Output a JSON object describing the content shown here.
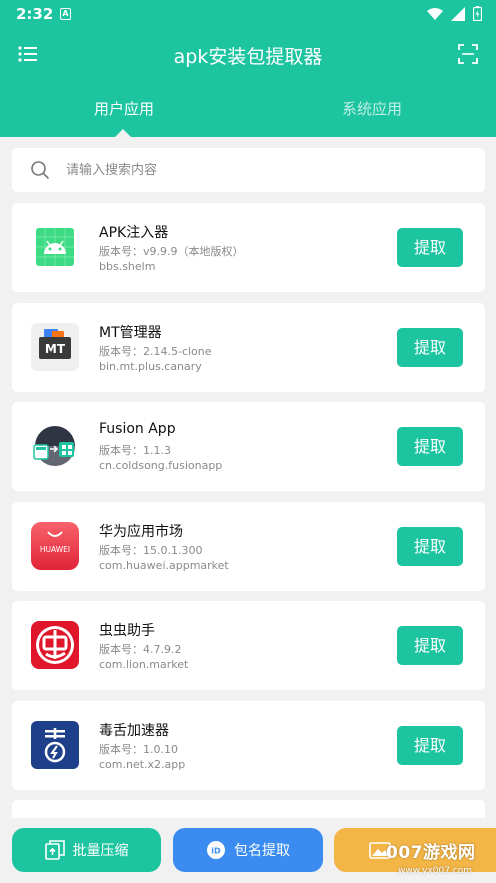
{
  "status_bar": {
    "time": "2:32",
    "notify_glyph": "A"
  },
  "toolbar": {
    "title": "apk安装包提取器",
    "menu_icon": "menu-icon",
    "scan_icon": "scan-icon"
  },
  "tabs": [
    {
      "label": "用户应用",
      "selected": true
    },
    {
      "label": "系统应用",
      "selected": false
    }
  ],
  "search": {
    "placeholder": "请输入搜索内容",
    "value": ""
  },
  "apps": [
    {
      "name": "APK注入器",
      "version": "版本号：v9.9.9（本地版权）",
      "package": "bbs.shelm",
      "button": "提取",
      "icon": "android-icon"
    },
    {
      "name": "MT管理器",
      "version": "版本号：2.14.5-clone",
      "package": "bin.mt.plus.canary",
      "button": "提取",
      "icon": "mt-manager-icon"
    },
    {
      "name": "Fusion App",
      "version": "版本号：1.1.3",
      "package": "cn.coldsong.fusionapp",
      "button": "提取",
      "icon": "fusion-app-icon"
    },
    {
      "name": "华为应用市场",
      "version": "版本号：15.0.1.300",
      "package": "com.huawei.appmarket",
      "button": "提取",
      "icon": "huawei-appmarket-icon",
      "icon_text": "HUAWEI"
    },
    {
      "name": "虫虫助手",
      "version": "版本号：4.7.9.2",
      "package": "com.lion.market",
      "button": "提取",
      "icon": "chongchong-icon"
    },
    {
      "name": "毒舌加速器",
      "version": "版本号：1.0.10",
      "package": "com.net.x2.app",
      "button": "提取",
      "icon": "dushe-icon"
    }
  ],
  "bottom_bar": {
    "batch_label": "批量压缩",
    "pkg_label": "包名提取"
  },
  "watermark": {
    "text": "007游戏网",
    "url": "www.yx007.com"
  },
  "colors": {
    "primary": "#1dc4a0",
    "blue": "#3a8cf0",
    "orange": "#f3b546"
  }
}
